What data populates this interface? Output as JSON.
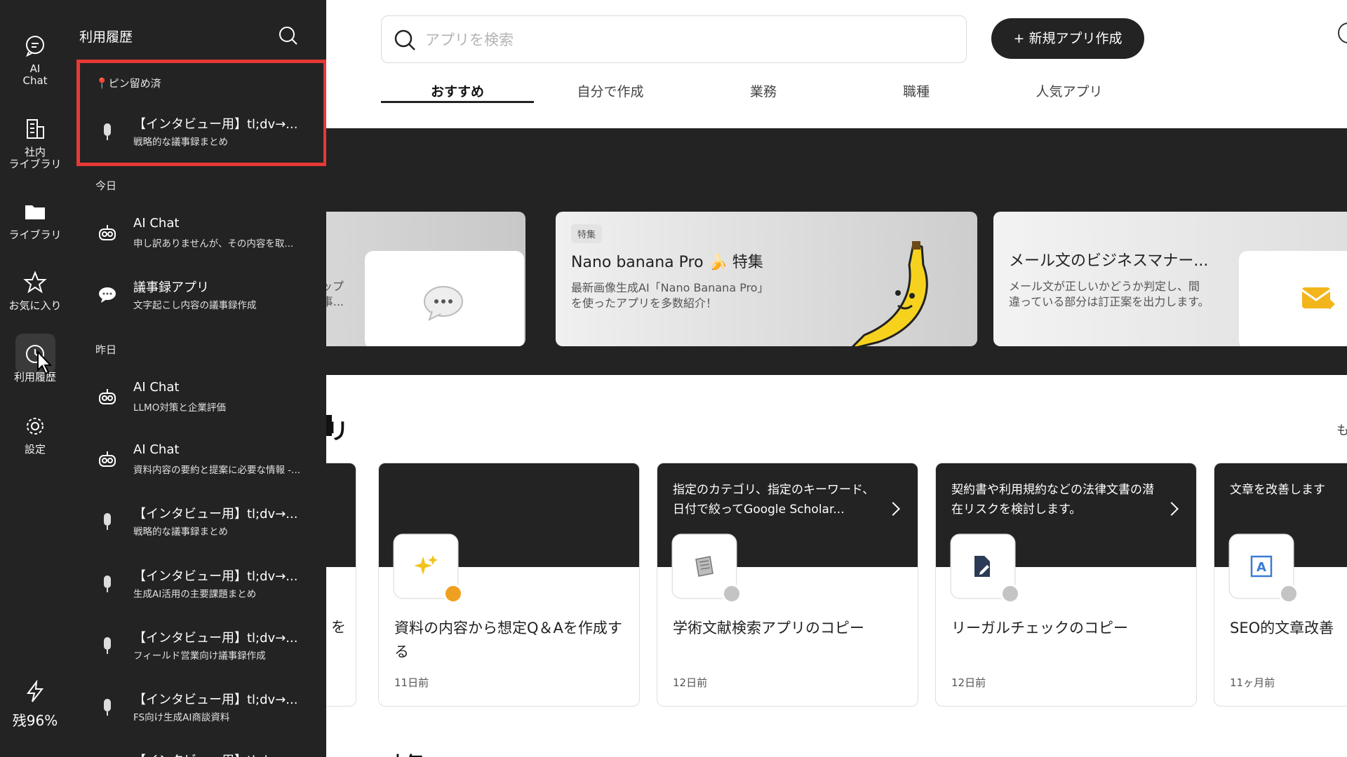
{
  "rail": {
    "items": [
      {
        "label": "AI\nChat",
        "icon": "chat-bubble-icon"
      },
      {
        "label": "社内\nライブラリ",
        "icon": "building-icon"
      },
      {
        "label": "ライブラリ",
        "icon": "folder-icon"
      },
      {
        "label": "お気に入り",
        "icon": "star-icon"
      },
      {
        "label": "利用履歴",
        "icon": "history-clock-icon"
      },
      {
        "label": "設定",
        "icon": "gear-icon"
      }
    ],
    "quota": "残96%"
  },
  "panel": {
    "title": "利用履歴",
    "pinned_label": "📍ピン留め済",
    "pinned": [
      {
        "title": "【インタビュー用】tl;dv→...",
        "subtitle": "戦略的な議事録まとめ"
      }
    ],
    "today_label": "今日",
    "today": [
      {
        "title": "AI Chat",
        "subtitle": "申し訳ありませんが、その内容を取..."
      },
      {
        "title": "議事録アプリ",
        "subtitle": "文字起こし内容の議事録作成"
      }
    ],
    "yesterday_label": "昨日",
    "yesterday": [
      {
        "title": "AI Chat",
        "subtitle": "LLMO対策と企業評価"
      },
      {
        "title": "AI Chat",
        "subtitle": "資料内容の要約と提案に必要な情報 -..."
      },
      {
        "title": "【インタビュー用】tl;dv→...",
        "subtitle": "戦略的な議事録まとめ"
      },
      {
        "title": "【インタビュー用】tl;dv→...",
        "subtitle": "生成AI活用の主要課題まとめ"
      },
      {
        "title": "【インタビュー用】tl;dv→...",
        "subtitle": "フィールド営業向け議事録作成"
      },
      {
        "title": "【インタビュー用】tl;dv→...",
        "subtitle": "FS向け生成AI商談資料"
      }
    ],
    "partial_title": "【インタビュー用】tl;dv→..."
  },
  "main": {
    "search_placeholder": "アプリを検索",
    "new_app_label": "+ 新規アプリ作成",
    "tabs": [
      "おすすめ",
      "自分で作成",
      "業務",
      "職種",
      "人気アプリ"
    ],
    "featured": {
      "partial_lines": "ップ\n事...",
      "card2": {
        "tag": "特集",
        "title": "Nano banana Pro 🍌 特集",
        "desc": "最新画像生成AI「Nano Banana Pro」\nを使ったアプリを多数紹介！"
      },
      "card3": {
        "title": "メール文のビジネスマナー...",
        "desc": "メール文が正しいかどうか判定し、間\n違っている部分は訂正案を出力します。"
      }
    },
    "section_heading_partial": "リ",
    "more_partial": "も",
    "cards_partial_text": "を",
    "cards": [
      {
        "top_text": "",
        "name": "資料の内容から想定Q＆Aを作成する",
        "time": "11日前",
        "icon": "sparkles-icon",
        "star_color": "#f0a020"
      },
      {
        "top_text": "指定のカテゴリ、指定のキーワード、日付で絞ってGoogle Scholar...",
        "name": "学術文献検索アプリのコピー",
        "time": "12日前",
        "icon": "newspaper-icon",
        "star_color": "#c4c4c4"
      },
      {
        "top_text": "契約書や利用規約などの法律文書の潜在リスクを検討します。",
        "name": "リーガルチェックのコピー",
        "time": "12日前",
        "icon": "document-pen-icon",
        "star_color": "#c4c4c4"
      },
      {
        "top_text": "文章を改善します",
        "name": "SEO的文章改善",
        "time": "11ヶ月前",
        "icon": "text-frame-icon",
        "star_color": "#c4c4c4"
      }
    ],
    "bottom_partial": "人気"
  }
}
